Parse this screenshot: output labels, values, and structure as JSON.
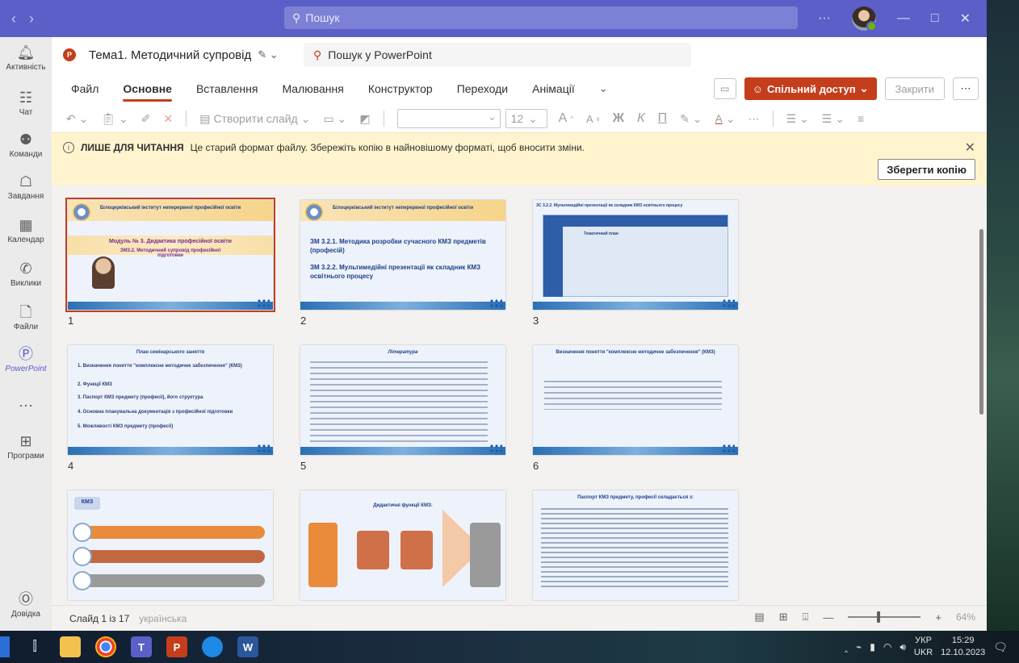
{
  "teams": {
    "search_placeholder": "Пошук",
    "more": "···",
    "rail": [
      {
        "label": "Активність",
        "icon": "bell-icon"
      },
      {
        "label": "Чат",
        "icon": "chat-icon"
      },
      {
        "label": "Команди",
        "icon": "teams-icon"
      },
      {
        "label": "Завдання",
        "icon": "assignments-icon"
      },
      {
        "label": "Календар",
        "icon": "calendar-icon"
      },
      {
        "label": "Виклики",
        "icon": "phone-icon"
      },
      {
        "label": "Файли",
        "icon": "file-icon"
      },
      {
        "label": "PowerPoint",
        "icon": "powerpoint-icon"
      },
      {
        "label": "Програми",
        "icon": "apps-icon"
      },
      {
        "label": "Довідка",
        "icon": "help-icon"
      }
    ]
  },
  "ppt": {
    "doc_title": "Тема1. Методичний супровід",
    "search_label": "Пошук у PowerPoint",
    "tabs": [
      "Файл",
      "Основне",
      "Вставлення",
      "Малювання",
      "Конструктор",
      "Переходи",
      "Анімації"
    ],
    "active_tab": "Основне",
    "share_label": "Спільний доступ",
    "close_label": "Закрити",
    "toolbar": {
      "new_slide": "Створити слайд",
      "font_size": "12",
      "bold": "Ж",
      "italic": "К",
      "underline": "П",
      "font_color": "А",
      "grow": "A",
      "shrink": "A"
    },
    "banner": {
      "bold": "ЛИШЕ ДЛЯ ЧИТАННЯ",
      "text": "Це старий формат файлу. Збережіть копію в найновішому форматі, щоб вносити зміни.",
      "save_copy": "Зберегти копію"
    },
    "slides": [
      {
        "num": "1",
        "title": "Білоцерківський інститут неперервної професійної освіти",
        "line1": "Модуль № 3. Дидактика професійної освіти",
        "line2": "ЗМ3.2. Методичний супровід професійної підготовки"
      },
      {
        "num": "2",
        "title": "Білоцерківський інститут неперервної професійної освіти",
        "line1": "ЗМ 3.2.1. Методика розробки сучасного КМЗ предметів (професій)",
        "line2": "ЗМ 3.2.2. Мультимедійні презентації як складник КМЗ освітнього процесу"
      },
      {
        "num": "3",
        "title": "ЗС 3.2.2. Мультимедійні презентації як складник КМЗ освітнього процесу",
        "line1": "Тематичний план",
        "line2": ""
      },
      {
        "num": "4",
        "title": "План семінарського заняття",
        "items": [
          "1. Визначення поняття \"комплексне методичне забезпечення\" (КМЗ)",
          "2. Функції КМЗ",
          "3. Паспорт КМЗ предмету (професії), його структура",
          "4. Основна планувальна документація з професійної підготовки",
          "5. Можливості КМЗ предмету (професії)"
        ]
      },
      {
        "num": "5",
        "title": "Література"
      },
      {
        "num": "6",
        "title": "Визначення поняття \"комплексне методичне забезпечення\" (КМЗ)"
      },
      {
        "num": "7",
        "title": "КМЗ"
      },
      {
        "num": "8",
        "title": "Дидактичні функції КМЗ:"
      },
      {
        "num": "9",
        "title": "Паспорт КМЗ предмету, професії складається з:"
      }
    ],
    "status": {
      "slide_of": "Слайд 1 із 17",
      "language": "українська",
      "zoom": "64%"
    }
  },
  "taskbar": {
    "lang_top": "УКР",
    "lang_bottom": "UKR",
    "time": "15:29",
    "date": "12.10.2023"
  }
}
